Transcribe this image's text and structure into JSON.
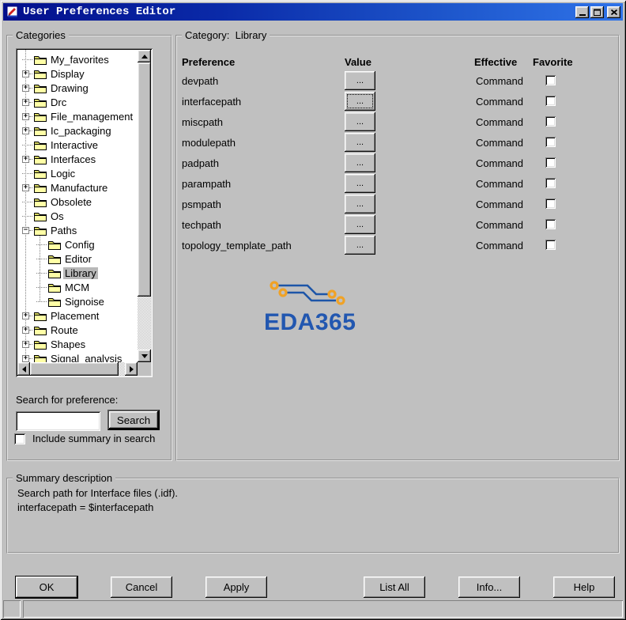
{
  "window": {
    "title": "User Preferences Editor",
    "controls": {
      "minimize": "minimize",
      "maximize": "maximize",
      "close": "close"
    }
  },
  "categories_panel": {
    "title": "Categories",
    "tree": [
      {
        "label": "My_favorites",
        "level": 1,
        "expander": "none",
        "selected": false
      },
      {
        "label": "Display",
        "level": 1,
        "expander": "plus",
        "selected": false
      },
      {
        "label": "Drawing",
        "level": 1,
        "expander": "plus",
        "selected": false
      },
      {
        "label": "Drc",
        "level": 1,
        "expander": "plus",
        "selected": false
      },
      {
        "label": "File_management",
        "level": 1,
        "expander": "plus",
        "selected": false
      },
      {
        "label": "Ic_packaging",
        "level": 1,
        "expander": "plus",
        "selected": false
      },
      {
        "label": "Interactive",
        "level": 1,
        "expander": "none",
        "selected": false
      },
      {
        "label": "Interfaces",
        "level": 1,
        "expander": "plus",
        "selected": false
      },
      {
        "label": "Logic",
        "level": 1,
        "expander": "none",
        "selected": false
      },
      {
        "label": "Manufacture",
        "level": 1,
        "expander": "plus",
        "selected": false
      },
      {
        "label": "Obsolete",
        "level": 1,
        "expander": "none",
        "selected": false
      },
      {
        "label": "Os",
        "level": 1,
        "expander": "none",
        "selected": false
      },
      {
        "label": "Paths",
        "level": 1,
        "expander": "minus",
        "selected": false
      },
      {
        "label": "Config",
        "level": 2,
        "expander": "none",
        "selected": false
      },
      {
        "label": "Editor",
        "level": 2,
        "expander": "none",
        "selected": false
      },
      {
        "label": "Library",
        "level": 2,
        "expander": "none",
        "selected": true
      },
      {
        "label": "MCM",
        "level": 2,
        "expander": "none",
        "selected": false
      },
      {
        "label": "Signoise",
        "level": 2,
        "expander": "none",
        "selected": false
      },
      {
        "label": "Placement",
        "level": 1,
        "expander": "plus",
        "selected": false
      },
      {
        "label": "Route",
        "level": 1,
        "expander": "plus",
        "selected": false
      },
      {
        "label": "Shapes",
        "level": 1,
        "expander": "plus",
        "selected": false
      },
      {
        "label": "Signal_analysis",
        "level": 1,
        "expander": "plus",
        "selected": false
      }
    ],
    "search_label": "Search for preference:",
    "search_value": "",
    "search_button_label": "Search",
    "include_summary_label": "Include summary in search",
    "include_summary_checked": false
  },
  "preferences_panel": {
    "title": "Category:  Library",
    "columns": {
      "preference": "Preference",
      "value": "Value",
      "effective": "Effective",
      "favorite": "Favorite"
    },
    "value_button_label": "...",
    "rows": [
      {
        "name": "devpath",
        "effective": "Command",
        "favorite": false,
        "focused": false
      },
      {
        "name": "interfacepath",
        "effective": "Command",
        "favorite": false,
        "focused": true
      },
      {
        "name": "miscpath",
        "effective": "Command",
        "favorite": false,
        "focused": false
      },
      {
        "name": "modulepath",
        "effective": "Command",
        "favorite": false,
        "focused": false
      },
      {
        "name": "padpath",
        "effective": "Command",
        "favorite": false,
        "focused": false
      },
      {
        "name": "parampath",
        "effective": "Command",
        "favorite": false,
        "focused": false
      },
      {
        "name": "psmpath",
        "effective": "Command",
        "favorite": false,
        "focused": false
      },
      {
        "name": "techpath",
        "effective": "Command",
        "favorite": false,
        "focused": false
      },
      {
        "name": "topology_template_path",
        "effective": "Command",
        "favorite": false,
        "focused": false
      }
    ],
    "watermark": {
      "text": "EDA365",
      "text_color": "#2257b0",
      "trace_color": "#1d55a8",
      "via_color": "#f0a226"
    }
  },
  "summary_panel": {
    "title": "Summary description",
    "lines": [
      "Search path for Interface files (.idf).",
      "interfacepath = $interfacepath"
    ]
  },
  "action_buttons": [
    {
      "label": "OK",
      "default": true
    },
    {
      "label": "Cancel",
      "default": false
    },
    {
      "label": "Apply",
      "default": false
    },
    {
      "label": "List All",
      "default": false
    },
    {
      "label": "Info...",
      "default": false
    },
    {
      "label": "Help",
      "default": false
    }
  ],
  "status_bar": {
    "text": ""
  }
}
